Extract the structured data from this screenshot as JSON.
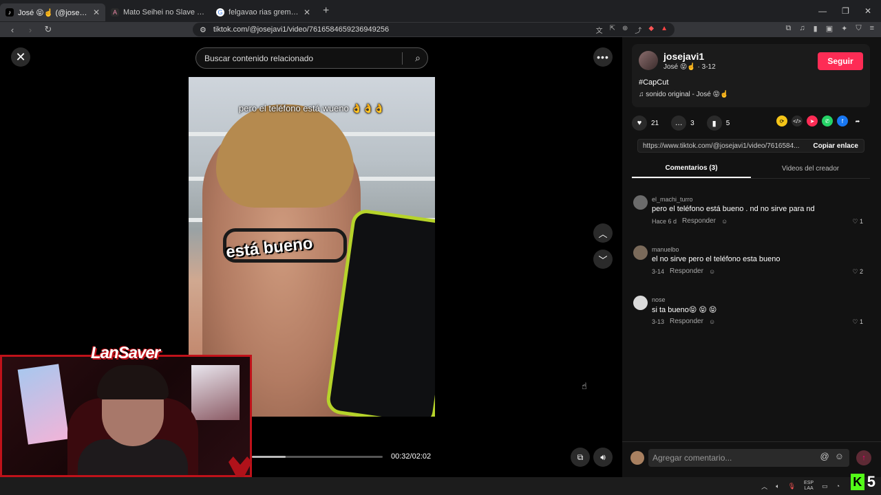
{
  "browser": {
    "tabs": [
      {
        "title": "José 😝☝️ (@josejavi1) | TikT",
        "icon": "tiktok-icon",
        "active": true
      },
      {
        "title": "Mato Seihei no Slave Episodio 8 Sub",
        "icon": "anime-site-icon",
        "active": false
      },
      {
        "title": "felgavao rias gremory - Buscar con G",
        "icon": "google-icon",
        "active": false
      }
    ],
    "url": "tiktok.com/@josejavi1/video/7616584659236949256"
  },
  "video_stage": {
    "search_placeholder": "Buscar contenido relacionado",
    "caption_top": "pero el teléfono está wueno 👌👌👌",
    "caption_mid": "está bueno",
    "time": "00:32/02:02",
    "progress": 0.26
  },
  "overlay": {
    "brand": "LanSaver"
  },
  "creator": {
    "username": "josejavi1",
    "subtitle": "José 😝☝️ · 3-12",
    "follow_label": "Seguir",
    "hashtag": "#CapCut",
    "music": "♫  sonido original - José 😝☝️"
  },
  "actions": {
    "likes": "21",
    "comments": "3",
    "saves": "5"
  },
  "share": {
    "link": "https://www.tiktok.com/@josejavi1/video/7616584...",
    "copy_label": "Copiar enlace"
  },
  "tabs": {
    "comments": "Comentarios (3)",
    "creator_videos": "Videos del creador"
  },
  "comments": [
    {
      "user": "el_machi_turro",
      "text": "pero el teléfono está bueno . nd no sirve para nd",
      "time": "Hace 6 d",
      "reply": "Responder",
      "likes": "1"
    },
    {
      "user": "manuelbo",
      "text": "el no sirve pero el teléfono esta bueno",
      "time": "3-14",
      "reply": "Responder",
      "likes": "2"
    },
    {
      "user": "nose",
      "text": "si ta bueno😝 😝 😝",
      "time": "3-13",
      "reply": "Responder",
      "likes": "1"
    }
  ],
  "comment_input": {
    "placeholder": "Agregar comentario..."
  },
  "taskbar": {
    "lang_top": "ESP",
    "lang_bottom": "LAA",
    "kick_count": "5"
  }
}
